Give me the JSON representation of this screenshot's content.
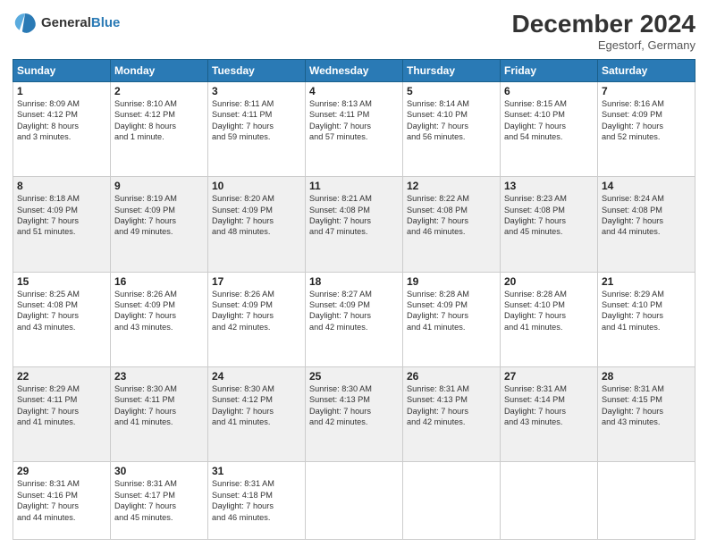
{
  "header": {
    "logo_line1": "General",
    "logo_line2": "Blue",
    "month": "December 2024",
    "location": "Egestorf, Germany"
  },
  "days_of_week": [
    "Sunday",
    "Monday",
    "Tuesday",
    "Wednesday",
    "Thursday",
    "Friday",
    "Saturday"
  ],
  "weeks": [
    [
      {
        "day": "1",
        "sunrise": "8:09 AM",
        "sunset": "4:12 PM",
        "daylight": "8 hours and 3 minutes."
      },
      {
        "day": "2",
        "sunrise": "8:10 AM",
        "sunset": "4:12 PM",
        "daylight": "8 hours and 1 minute."
      },
      {
        "day": "3",
        "sunrise": "8:11 AM",
        "sunset": "4:11 PM",
        "daylight": "7 hours and 59 minutes."
      },
      {
        "day": "4",
        "sunrise": "8:13 AM",
        "sunset": "4:11 PM",
        "daylight": "7 hours and 57 minutes."
      },
      {
        "day": "5",
        "sunrise": "8:14 AM",
        "sunset": "4:10 PM",
        "daylight": "7 hours and 56 minutes."
      },
      {
        "day": "6",
        "sunrise": "8:15 AM",
        "sunset": "4:10 PM",
        "daylight": "7 hours and 54 minutes."
      },
      {
        "day": "7",
        "sunrise": "8:16 AM",
        "sunset": "4:09 PM",
        "daylight": "7 hours and 52 minutes."
      }
    ],
    [
      {
        "day": "8",
        "sunrise": "8:18 AM",
        "sunset": "4:09 PM",
        "daylight": "7 hours and 51 minutes."
      },
      {
        "day": "9",
        "sunrise": "8:19 AM",
        "sunset": "4:09 PM",
        "daylight": "7 hours and 49 minutes."
      },
      {
        "day": "10",
        "sunrise": "8:20 AM",
        "sunset": "4:09 PM",
        "daylight": "7 hours and 48 minutes."
      },
      {
        "day": "11",
        "sunrise": "8:21 AM",
        "sunset": "4:08 PM",
        "daylight": "7 hours and 47 minutes."
      },
      {
        "day": "12",
        "sunrise": "8:22 AM",
        "sunset": "4:08 PM",
        "daylight": "7 hours and 46 minutes."
      },
      {
        "day": "13",
        "sunrise": "8:23 AM",
        "sunset": "4:08 PM",
        "daylight": "7 hours and 45 minutes."
      },
      {
        "day": "14",
        "sunrise": "8:24 AM",
        "sunset": "4:08 PM",
        "daylight": "7 hours and 44 minutes."
      }
    ],
    [
      {
        "day": "15",
        "sunrise": "8:25 AM",
        "sunset": "4:08 PM",
        "daylight": "7 hours and 43 minutes."
      },
      {
        "day": "16",
        "sunrise": "8:26 AM",
        "sunset": "4:09 PM",
        "daylight": "7 hours and 43 minutes."
      },
      {
        "day": "17",
        "sunrise": "8:26 AM",
        "sunset": "4:09 PM",
        "daylight": "7 hours and 42 minutes."
      },
      {
        "day": "18",
        "sunrise": "8:27 AM",
        "sunset": "4:09 PM",
        "daylight": "7 hours and 42 minutes."
      },
      {
        "day": "19",
        "sunrise": "8:28 AM",
        "sunset": "4:09 PM",
        "daylight": "7 hours and 41 minutes."
      },
      {
        "day": "20",
        "sunrise": "8:28 AM",
        "sunset": "4:10 PM",
        "daylight": "7 hours and 41 minutes."
      },
      {
        "day": "21",
        "sunrise": "8:29 AM",
        "sunset": "4:10 PM",
        "daylight": "7 hours and 41 minutes."
      }
    ],
    [
      {
        "day": "22",
        "sunrise": "8:29 AM",
        "sunset": "4:11 PM",
        "daylight": "7 hours and 41 minutes."
      },
      {
        "day": "23",
        "sunrise": "8:30 AM",
        "sunset": "4:11 PM",
        "daylight": "7 hours and 41 minutes."
      },
      {
        "day": "24",
        "sunrise": "8:30 AM",
        "sunset": "4:12 PM",
        "daylight": "7 hours and 41 minutes."
      },
      {
        "day": "25",
        "sunrise": "8:30 AM",
        "sunset": "4:13 PM",
        "daylight": "7 hours and 42 minutes."
      },
      {
        "day": "26",
        "sunrise": "8:31 AM",
        "sunset": "4:13 PM",
        "daylight": "7 hours and 42 minutes."
      },
      {
        "day": "27",
        "sunrise": "8:31 AM",
        "sunset": "4:14 PM",
        "daylight": "7 hours and 43 minutes."
      },
      {
        "day": "28",
        "sunrise": "8:31 AM",
        "sunset": "4:15 PM",
        "daylight": "7 hours and 43 minutes."
      }
    ],
    [
      {
        "day": "29",
        "sunrise": "8:31 AM",
        "sunset": "4:16 PM",
        "daylight": "7 hours and 44 minutes."
      },
      {
        "day": "30",
        "sunrise": "8:31 AM",
        "sunset": "4:17 PM",
        "daylight": "7 hours and 45 minutes."
      },
      {
        "day": "31",
        "sunrise": "8:31 AM",
        "sunset": "4:18 PM",
        "daylight": "7 hours and 46 minutes."
      },
      null,
      null,
      null,
      null
    ]
  ],
  "labels": {
    "sunrise": "Sunrise:",
    "sunset": "Sunset:",
    "daylight": "Daylight hours"
  }
}
